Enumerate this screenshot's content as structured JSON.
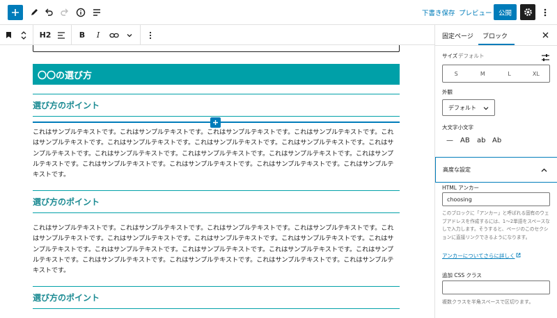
{
  "topbar": {
    "save_draft": "下書き保存",
    "preview": "プレビュー",
    "publish": "公開"
  },
  "toolbar": {
    "heading_level": "H2",
    "bold": "B",
    "italic": "I"
  },
  "content": {
    "h2": "〇〇の選び方",
    "h3_1": "選び方のポイント",
    "h3_2": "選び方のポイント",
    "h3_3": "選び方のポイント",
    "para1": "これはサンプルテキストです。これはサンプルテキストです。これはサンプルテキストです。これはサンプルテキストです。これはサンプルテキストです。これはサンプルテキストです。これはサンプルテキストです。これはサンプルテキストです。これはサンプルテキストです。これはサンプルテキストです。これはサンプルテキストです。これはサンプルテキストです。これはサンプルテキストです。これはサンプルテキストです。これはサンプルテキストです。これはサンプルテキストです。これはサンプルテキストです。",
    "para2": "これはサンプルテキストです。これはサンプルテキストです。これはサンプルテキストです。これはサンプルテキストです。これはサンプルテキストです。これはサンプルテキストです。これはサンプルテキストです。これはサンプルテキストです。これはサンプルテキストです。これはサンプルテキストです。これはサンプルテキストです。これはサンプルテキストです。これはサンプルテキストです。これはサンプルテキストです。これはサンプルテキストです。これはサンプルテキストです。これはサンプルテキストです。"
  },
  "sidebar": {
    "tab_post": "固定ページ",
    "tab_block": "ブロック",
    "size_label": "サイズ",
    "size_value": "デフォルト",
    "sizes": [
      "S",
      "M",
      "L",
      "XL"
    ],
    "appearance_label": "外観",
    "appearance_value": "デフォルト",
    "case_label": "大文字小文字",
    "case_options": [
      "—",
      "AB",
      "ab",
      "Ab"
    ],
    "advanced_title": "高度な設定",
    "anchor_label": "HTML アンカー",
    "anchor_value": "choosing",
    "anchor_help": "このブロックに「アンカー」と呼ばれる固有のウェブアドレスを作成するには、1〜2単語をスペースなしで入力します。そうすると、ページのこのセクションに直接リンクできるようになります。",
    "learn_more": "アンカーについてさらに詳しく",
    "css_label": "追加 CSS クラス",
    "css_help": "複数クラスを半角スペースで区切ります。"
  },
  "colors": {
    "accent": "#007cba",
    "heading_bg": "#00a0a8",
    "heading_text": "#1a8a92"
  }
}
